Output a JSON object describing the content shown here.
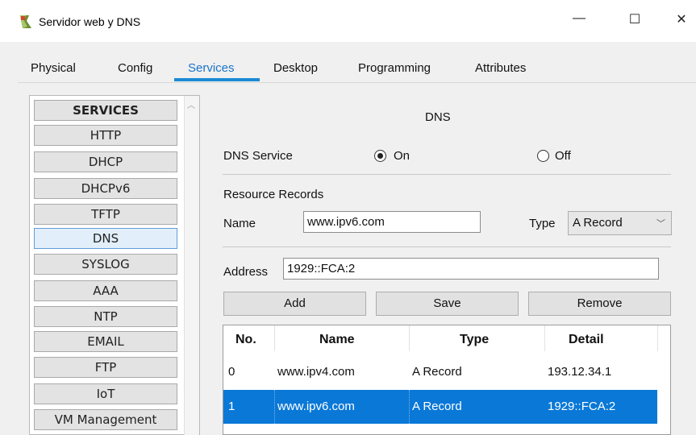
{
  "window": {
    "title": "Servidor web y DNS",
    "controls": {
      "minimize": "—",
      "maximize": "☐",
      "close": "✕"
    }
  },
  "tabs": [
    {
      "label": "Physical"
    },
    {
      "label": "Config"
    },
    {
      "label": "Services",
      "active": true
    },
    {
      "label": "Desktop"
    },
    {
      "label": "Programming"
    },
    {
      "label": "Attributes"
    }
  ],
  "services": {
    "header": "SERVICES",
    "items": [
      "HTTP",
      "DHCP",
      "DHCPv6",
      "TFTP",
      "DNS",
      "SYSLOG",
      "AAA",
      "NTP",
      "EMAIL",
      "FTP",
      "IoT",
      "VM Management"
    ],
    "selected": "DNS"
  },
  "dns": {
    "title": "DNS",
    "service_label": "DNS Service",
    "on_label": "On",
    "off_label": "Off",
    "service_state": "On",
    "resource_records_label": "Resource Records",
    "name_label": "Name",
    "name_value": "www.ipv6.com",
    "type_label": "Type",
    "type_value": "A Record",
    "address_label": "Address",
    "address_value": "1929::FCA:2",
    "add_label": "Add",
    "save_label": "Save",
    "remove_label": "Remove"
  },
  "table": {
    "headers": [
      "No.",
      "Name",
      "Type",
      "Detail"
    ],
    "rows": [
      [
        "0",
        "www.ipv4.com",
        "A Record",
        "193.12.34.1"
      ],
      [
        "1",
        "www.ipv6.com",
        "A Record",
        "1929::FCA:2"
      ]
    ],
    "selected_row": 1
  },
  "colors": {
    "accent": "#1a8ad4",
    "selection": "#0a78d7"
  }
}
